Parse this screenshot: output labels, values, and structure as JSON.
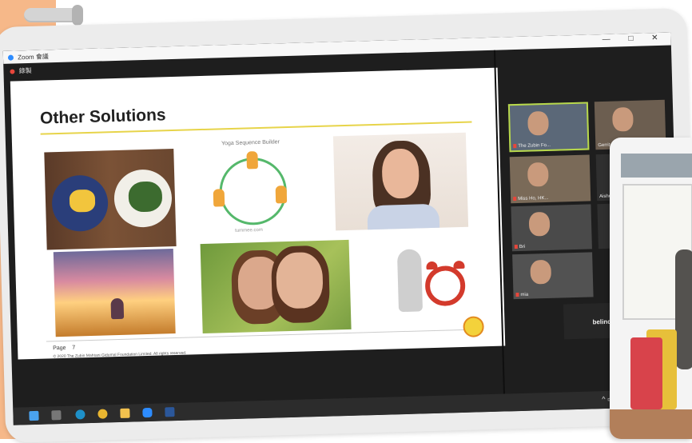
{
  "zoom": {
    "title": "Zoom 會議",
    "recording": "錄製"
  },
  "window_controls": [
    "—",
    "□",
    "✕"
  ],
  "slide": {
    "title": "Other Solutions",
    "yoga_title": "Yoga Sequence Builder",
    "yoga_site": "tummee.com",
    "page_label": "Page",
    "page_number": "7",
    "copyright": "© 2020 The Zubin Mahtani Gidumal Foundation Limited. All rights reserved."
  },
  "participants": [
    {
      "name": "The Zubin Fo..."
    },
    {
      "name": "Gerrit"
    },
    {
      "name": "Miss Ho, HK..."
    },
    {
      "name": "Aishe"
    },
    {
      "name": "Bri"
    },
    {
      "name": "mia"
    },
    {
      "name": "belinda"
    }
  ],
  "taskbar": {
    "tray": "^ ▭ 🔈"
  },
  "colors": {
    "accent": "#f6b889",
    "active_speaker": "#b8d84a",
    "slide_rule": "#e7d44a"
  }
}
